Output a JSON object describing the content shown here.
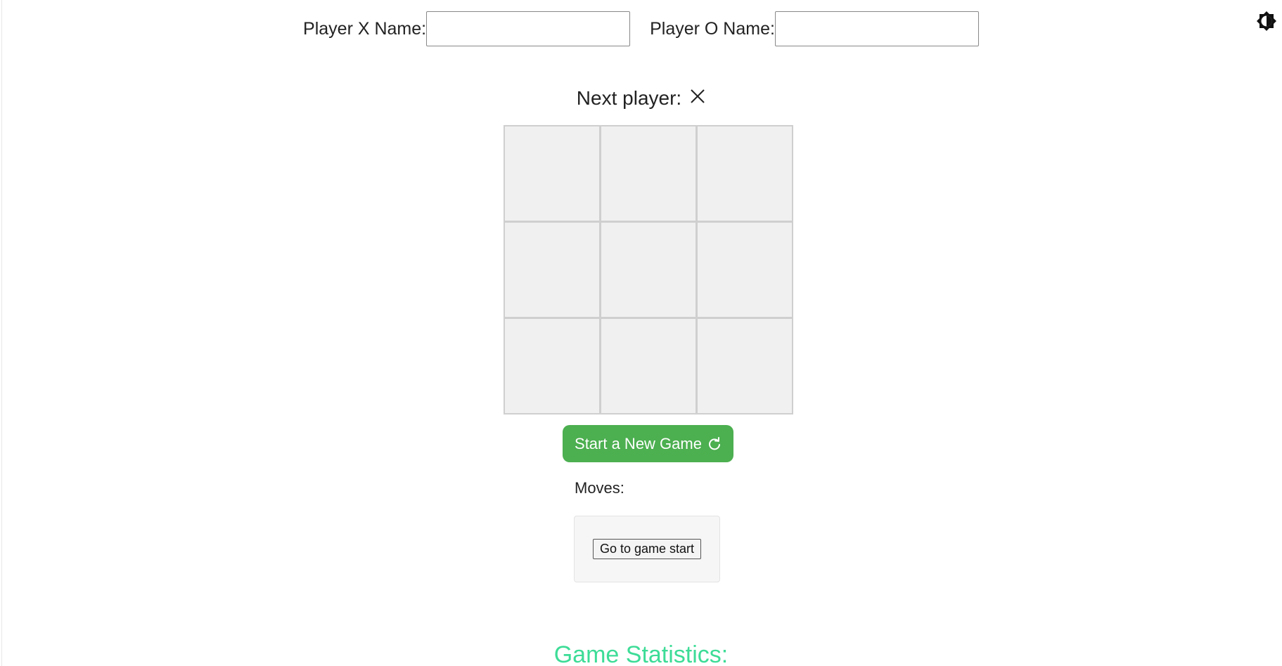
{
  "player_names": {
    "x_label": "Player X Name:",
    "x_value": "",
    "o_label": "Player O Name:",
    "o_value": ""
  },
  "theme_toggle": {
    "icon": "brightness-icon"
  },
  "status": {
    "label": "Next player:",
    "symbol": "×",
    "symbol_icon": "x-mark-icon"
  },
  "board": {
    "squares": [
      "",
      "",
      "",
      "",
      "",
      "",
      "",
      "",
      ""
    ]
  },
  "new_game_button": {
    "label": "Start a New Game",
    "icon": "refresh-icon",
    "color": "#4caf50"
  },
  "moves": {
    "label": "Moves:",
    "items": [
      "Go to game start"
    ]
  },
  "statistics": {
    "title": "Game Statistics:",
    "color": "#3ddc97"
  }
}
